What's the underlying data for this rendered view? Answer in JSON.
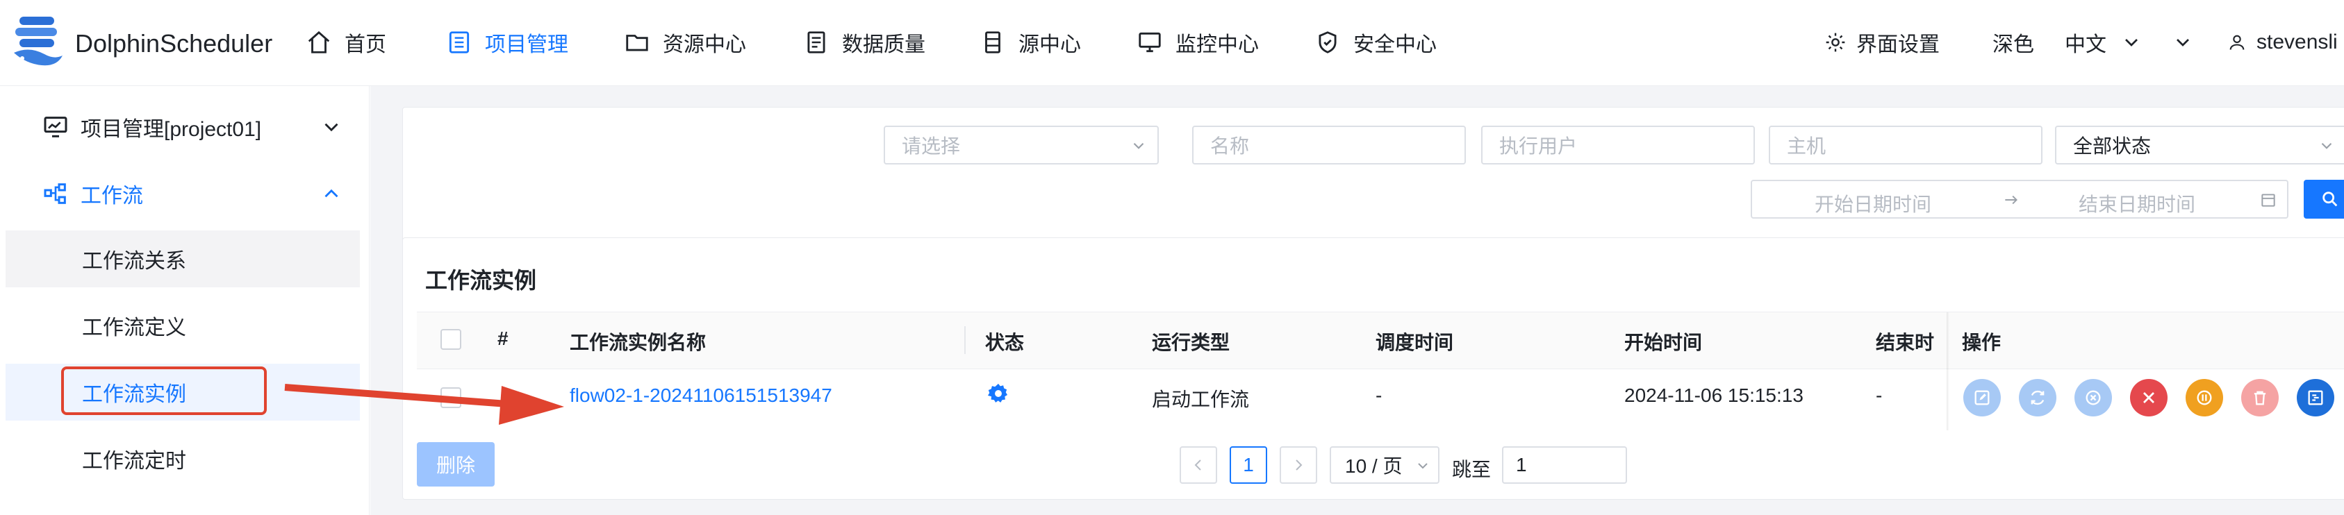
{
  "header": {
    "brand": "DolphinScheduler",
    "nav": [
      {
        "label": "首页",
        "icon": "home-icon"
      },
      {
        "label": "项目管理",
        "icon": "project-icon",
        "active": true
      },
      {
        "label": "资源中心",
        "icon": "folder-icon"
      },
      {
        "label": "数据质量",
        "icon": "data-quality-icon"
      },
      {
        "label": "源中心",
        "icon": "datasource-icon"
      },
      {
        "label": "监控中心",
        "icon": "monitor-icon"
      },
      {
        "label": "安全中心",
        "icon": "shield-icon"
      }
    ],
    "ui_settings": "界面设置",
    "theme": "深色",
    "language": "中文",
    "user": "stevensli"
  },
  "sidebar": {
    "project": "项目管理[project01]",
    "workflow_group": "工作流",
    "items": [
      "工作流关系",
      "工作流定义",
      "工作流实例",
      "工作流定时"
    ]
  },
  "filters": {
    "select_placeholder": "请选择",
    "name_placeholder": "名称",
    "executor_placeholder": "执行用户",
    "host_placeholder": "主机",
    "status_value": "全部状态",
    "start_placeholder": "开始日期时间",
    "end_placeholder": "结束日期时间"
  },
  "table": {
    "title": "工作流实例",
    "columns": [
      "#",
      "工作流实例名称",
      "状态",
      "运行类型",
      "调度时间",
      "开始时间",
      "结束时",
      "操作"
    ],
    "rows": [
      {
        "name": "flow02-1-20241106151513947",
        "run_type": "启动工作流",
        "schedule_time": "-",
        "start_time": "2024-11-06 15:15:13",
        "end_time": "-"
      }
    ]
  },
  "footer": {
    "delete_label": "删除",
    "current_page": "1",
    "page_size": "10 / 页",
    "jump_label": "跳至",
    "jump_value": "1"
  },
  "colors": {
    "primary": "#1677ff",
    "annotation_red": "#e0432f",
    "op_edit": "#a7c9f5",
    "op_rerun": "#a7c9f5",
    "op_recover": "#a7c9f5",
    "op_stop": "#e5484d",
    "op_pause": "#f0a020",
    "op_delete": "#f5a3a3",
    "op_gantt": "#1e6fd9"
  }
}
